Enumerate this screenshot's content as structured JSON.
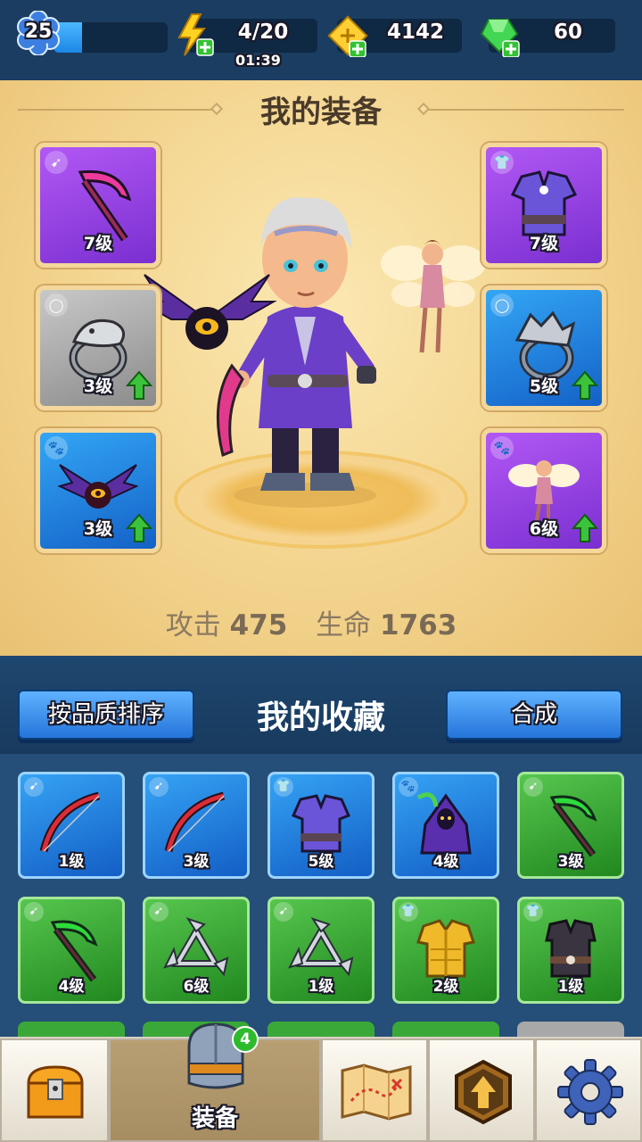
{
  "topbar": {
    "level": "25",
    "xp_progress": 0.25,
    "energy": "4/20",
    "energy_timer": "01:39",
    "gold": "4142",
    "gems": "60"
  },
  "equipment": {
    "title": "我的装备",
    "left_slots": [
      {
        "category_icon": "bow-icon",
        "item": "scythe-icon",
        "level": "7级",
        "rarity": "purple",
        "upgrade": false
      },
      {
        "category_icon": "ring-icon",
        "item": "snake-ring-icon",
        "level": "3级",
        "rarity": "gray",
        "upgrade": true
      },
      {
        "category_icon": "paw-icon",
        "item": "bat-pet-icon",
        "level": "3级",
        "rarity": "blue",
        "upgrade": true
      }
    ],
    "right_slots": [
      {
        "category_icon": "armor-icon",
        "item": "robe-icon",
        "level": "7级",
        "rarity": "purple",
        "upgrade": false
      },
      {
        "category_icon": "ring-icon",
        "item": "claw-ring-icon",
        "level": "5级",
        "rarity": "blue",
        "upgrade": true
      },
      {
        "category_icon": "paw-icon",
        "item": "fairy-pet-icon",
        "level": "6级",
        "rarity": "purple",
        "upgrade": true
      }
    ],
    "attack_label": "攻击",
    "attack_value": "475",
    "hp_label": "生命",
    "hp_value": "1763"
  },
  "collection": {
    "sort_button": "按品质排序",
    "title": "我的收藏",
    "merge_button": "合成",
    "items": [
      {
        "category_icon": "bow-icon",
        "item": "red-bow-icon",
        "level": "1级",
        "rarity": "blue"
      },
      {
        "category_icon": "bow-icon",
        "item": "red-bow-icon",
        "level": "3级",
        "rarity": "blue"
      },
      {
        "category_icon": "armor-icon",
        "item": "robe-icon",
        "level": "5级",
        "rarity": "blue"
      },
      {
        "category_icon": "paw-icon",
        "item": "reaper-pet-icon",
        "level": "4级",
        "rarity": "blue"
      },
      {
        "category_icon": "bow-icon",
        "item": "green-scythe-icon",
        "level": "3级",
        "rarity": "green"
      },
      {
        "category_icon": "bow-icon",
        "item": "green-scythe-icon",
        "level": "4级",
        "rarity": "green"
      },
      {
        "category_icon": "bow-icon",
        "item": "shuriken-icon",
        "level": "6级",
        "rarity": "green"
      },
      {
        "category_icon": "bow-icon",
        "item": "shuriken-icon",
        "level": "1级",
        "rarity": "green"
      },
      {
        "category_icon": "armor-icon",
        "item": "gold-armor-icon",
        "level": "2级",
        "rarity": "green"
      },
      {
        "category_icon": "armor-icon",
        "item": "dark-vest-icon",
        "level": "1级",
        "rarity": "green"
      }
    ]
  },
  "nav": {
    "equip_label": "装备",
    "equip_badge": "4",
    "items": [
      "chest-icon",
      "equipment-icon",
      "map-icon",
      "upgrade-icon",
      "settings-icon"
    ]
  },
  "colors": {
    "purple": "#9a45e8",
    "blue": "#1f82e3",
    "green": "#3aa838",
    "gray": "#a8a8a8",
    "upgrade": "#3cc23c"
  }
}
